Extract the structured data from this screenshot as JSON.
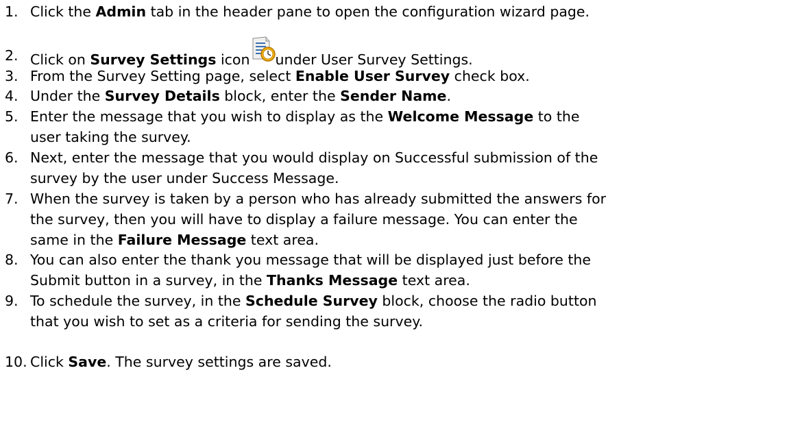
{
  "steps": [
    {
      "num": "1.",
      "lines": [
        [
          {
            "t": "Click the "
          },
          {
            "t": "Admin",
            "b": true
          },
          {
            "t": " tab in the header pane to open the configuration wizard page."
          }
        ]
      ]
    },
    {
      "num": "2.",
      "lines": [
        [
          {
            "t": "Click on "
          },
          {
            "t": "Survey Settings",
            "b": true
          },
          {
            "t": " icon"
          },
          {
            "icon": "survey-settings-icon"
          },
          {
            "t": "under User Survey Settings."
          }
        ]
      ]
    },
    {
      "num": "3.",
      "lines": [
        [
          {
            "t": "From the Survey Setting page, select "
          },
          {
            "t": "Enable User Survey",
            "b": true
          },
          {
            "t": " check box."
          }
        ]
      ]
    },
    {
      "num": "4.",
      "lines": [
        [
          {
            "t": "Under the "
          },
          {
            "t": "Survey Details",
            "b": true
          },
          {
            "t": " block, enter the "
          },
          {
            "t": "Sender Name",
            "b": true
          },
          {
            "t": "."
          }
        ]
      ]
    },
    {
      "num": "5.",
      "lines": [
        [
          {
            "t": "Enter the message that you wish to display as the "
          },
          {
            "t": "Welcome Message",
            "b": true
          },
          {
            "t": " to the"
          }
        ],
        [
          {
            "t": "user taking the survey."
          }
        ]
      ]
    },
    {
      "num": "6.",
      "lines": [
        [
          {
            "t": "Next, enter the message that you would display on Successful submission of the"
          }
        ],
        [
          {
            "t": "survey by the user under Success Message."
          }
        ]
      ]
    },
    {
      "num": "7.",
      "lines": [
        [
          {
            "t": "When the survey is taken by a person who has already submitted the answers for"
          }
        ],
        [
          {
            "t": "the survey, then you will have to display a failure message. You can enter the"
          }
        ],
        [
          {
            "t": "same in the "
          },
          {
            "t": "Failure Message",
            "b": true
          },
          {
            "t": " text area."
          }
        ]
      ]
    },
    {
      "num": "8.",
      "lines": [
        [
          {
            "t": "You can also enter the thank you message that will be displayed just before the"
          }
        ],
        [
          {
            "t": "Submit button in a survey, in the "
          },
          {
            "t": "Thanks Message",
            "b": true
          },
          {
            "t": " text area."
          }
        ]
      ]
    },
    {
      "num": "9.",
      "lines": [
        [
          {
            "t": "To schedule the survey, in the "
          },
          {
            "t": "Schedule Survey",
            "b": true
          },
          {
            "t": " block, choose the radio button"
          }
        ],
        [
          {
            "t": "that you wish to set as a criteria for sending the survey."
          }
        ]
      ]
    },
    {
      "num": "10.",
      "lines": [
        [
          {
            "t": "Click "
          },
          {
            "t": "Save",
            "b": true
          },
          {
            "t": ". The survey settings are saved."
          }
        ]
      ]
    }
  ]
}
